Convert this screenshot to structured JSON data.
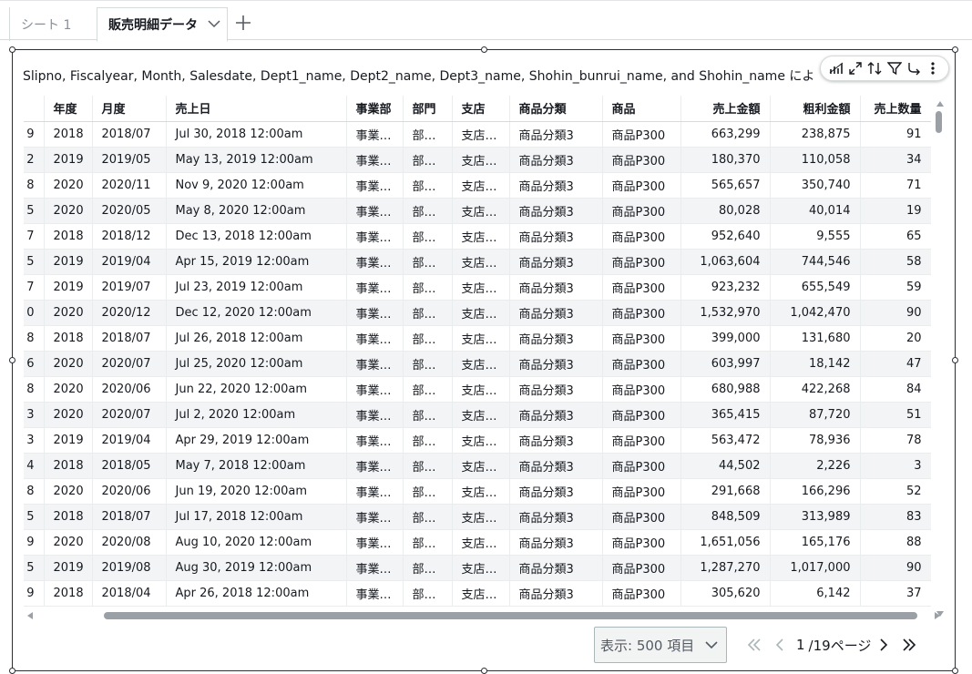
{
  "tabs": [
    {
      "label": "シート 1",
      "active": false
    },
    {
      "label": "販売明細データ",
      "active": true
    }
  ],
  "visual": {
    "title": "Slipno, Fiscalyear, Month, Salesdate, Dept1_name, Dept2_name, Dept3_name, Shohin_bunrui_name, and Shohin_name によ",
    "toolbar_icons": [
      "chart-type-icon",
      "expand-icon",
      "sort-icon",
      "filter-icon",
      "drill-icon",
      "more-options-icon"
    ]
  },
  "table": {
    "columns": [
      {
        "label": "",
        "align": "right"
      },
      {
        "label": "年度",
        "align": "left"
      },
      {
        "label": "月度",
        "align": "left"
      },
      {
        "label": "売上日",
        "align": "left"
      },
      {
        "label": "事業部",
        "align": "left"
      },
      {
        "label": "部門",
        "align": "left"
      },
      {
        "label": "支店",
        "align": "left"
      },
      {
        "label": "商品分類",
        "align": "left"
      },
      {
        "label": "商品",
        "align": "left"
      },
      {
        "label": "売上金額",
        "align": "right"
      },
      {
        "label": "粗利金額",
        "align": "right"
      },
      {
        "label": "売上数量",
        "align": "right"
      }
    ],
    "rows": [
      [
        "9",
        "2018",
        "2018/07",
        "Jul 30, 2018 12:00am",
        "事業…",
        "部…",
        "支店…",
        "商品分類3",
        "商品P300",
        "663,299",
        "238,875",
        "91"
      ],
      [
        "2",
        "2019",
        "2019/05",
        "May 13, 2019 12:00am",
        "事業…",
        "部…",
        "支店…",
        "商品分類3",
        "商品P300",
        "180,370",
        "110,058",
        "34"
      ],
      [
        "8",
        "2020",
        "2020/11",
        "Nov 9, 2020 12:00am",
        "事業…",
        "部…",
        "支店…",
        "商品分類3",
        "商品P300",
        "565,657",
        "350,740",
        "71"
      ],
      [
        "5",
        "2020",
        "2020/05",
        "May 8, 2020 12:00am",
        "事業…",
        "部…",
        "支店…",
        "商品分類3",
        "商品P300",
        "80,028",
        "40,014",
        "19"
      ],
      [
        "7",
        "2018",
        "2018/12",
        "Dec 13, 2018 12:00am",
        "事業…",
        "部…",
        "支店…",
        "商品分類3",
        "商品P300",
        "952,640",
        "9,555",
        "65"
      ],
      [
        "5",
        "2019",
        "2019/04",
        "Apr 15, 2019 12:00am",
        "事業…",
        "部…",
        "支店…",
        "商品分類3",
        "商品P300",
        "1,063,604",
        "744,546",
        "58"
      ],
      [
        "7",
        "2019",
        "2019/07",
        "Jul 23, 2019 12:00am",
        "事業…",
        "部…",
        "支店…",
        "商品分類3",
        "商品P300",
        "923,232",
        "655,549",
        "59"
      ],
      [
        "0",
        "2020",
        "2020/12",
        "Dec 12, 2020 12:00am",
        "事業…",
        "部…",
        "支店…",
        "商品分類3",
        "商品P300",
        "1,532,970",
        "1,042,470",
        "90"
      ],
      [
        "8",
        "2018",
        "2018/07",
        "Jul 26, 2018 12:00am",
        "事業…",
        "部…",
        "支店…",
        "商品分類3",
        "商品P300",
        "399,000",
        "131,680",
        "20"
      ],
      [
        "6",
        "2020",
        "2020/07",
        "Jul 25, 2020 12:00am",
        "事業…",
        "部…",
        "支店…",
        "商品分類3",
        "商品P300",
        "603,997",
        "18,142",
        "47"
      ],
      [
        "8",
        "2020",
        "2020/06",
        "Jun 22, 2020 12:00am",
        "事業…",
        "部…",
        "支店…",
        "商品分類3",
        "商品P300",
        "680,988",
        "422,268",
        "84"
      ],
      [
        "3",
        "2020",
        "2020/07",
        "Jul 2, 2020 12:00am",
        "事業…",
        "部…",
        "支店…",
        "商品分類3",
        "商品P300",
        "365,415",
        "87,720",
        "51"
      ],
      [
        "3",
        "2019",
        "2019/04",
        "Apr 29, 2019 12:00am",
        "事業…",
        "部…",
        "支店…",
        "商品分類3",
        "商品P300",
        "563,472",
        "78,936",
        "78"
      ],
      [
        "4",
        "2018",
        "2018/05",
        "May 7, 2018 12:00am",
        "事業…",
        "部…",
        "支店…",
        "商品分類3",
        "商品P300",
        "44,502",
        "2,226",
        "3"
      ],
      [
        "8",
        "2020",
        "2020/06",
        "Jun 19, 2020 12:00am",
        "事業…",
        "部…",
        "支店…",
        "商品分類3",
        "商品P300",
        "291,668",
        "166,296",
        "52"
      ],
      [
        "5",
        "2018",
        "2018/07",
        "Jul 17, 2018 12:00am",
        "事業…",
        "部…",
        "支店…",
        "商品分類3",
        "商品P300",
        "848,509",
        "313,989",
        "83"
      ],
      [
        "9",
        "2020",
        "2020/08",
        "Aug 10, 2020 12:00am",
        "事業…",
        "部…",
        "支店…",
        "商品分類3",
        "商品P300",
        "1,651,056",
        "165,176",
        "88"
      ],
      [
        "5",
        "2019",
        "2019/08",
        "Aug 30, 2019 12:00am",
        "事業…",
        "部…",
        "支店…",
        "商品分類3",
        "商品P300",
        "1,287,270",
        "1,017,000",
        "90"
      ],
      [
        "9",
        "2018",
        "2018/04",
        "Apr 26, 2018 12:00am",
        "事業…",
        "部…",
        "支店…",
        "商品分類3",
        "商品P300",
        "305,620",
        "6,142",
        "37"
      ]
    ]
  },
  "pager": {
    "page_size_label": "表示: 500 項目",
    "current_page": "1",
    "total_label": "/19ページ"
  }
}
